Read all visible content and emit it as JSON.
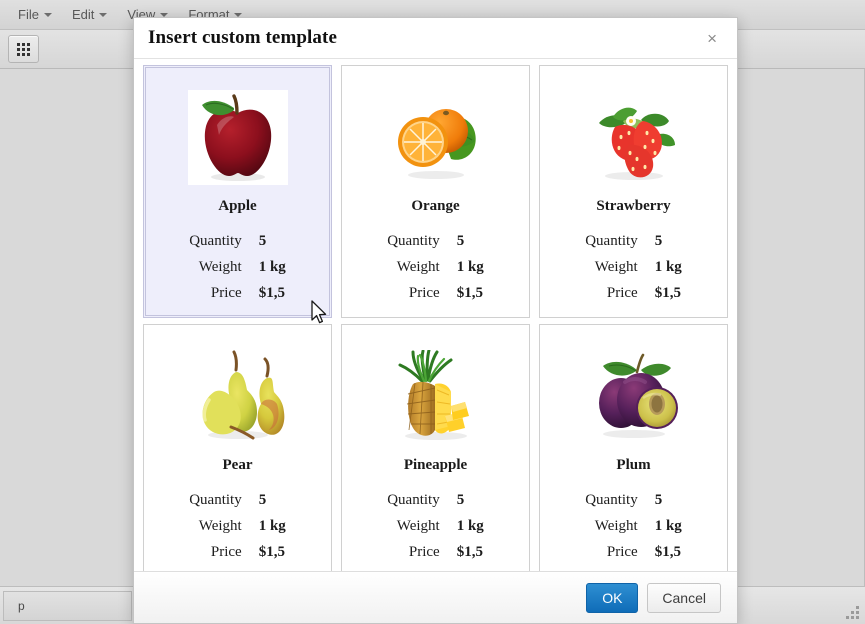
{
  "app": {
    "menubar": {
      "items": [
        {
          "label": "File",
          "has_caret": true
        },
        {
          "label": "Edit",
          "has_caret": true
        },
        {
          "label": "View",
          "has_caret": true
        },
        {
          "label": "Format",
          "has_caret": true
        }
      ]
    },
    "toolbar": {
      "buttons": [
        {
          "name": "insert-template-button",
          "icon": "grid-3x3-icon",
          "label": ""
        }
      ]
    },
    "statusbar": {
      "path": "p",
      "resize_grip": "resize-grip-icon"
    }
  },
  "dialog": {
    "title": "Insert custom template",
    "close_label": "×",
    "spec_labels": {
      "quantity": "Quantity",
      "weight": "Weight",
      "price": "Price"
    },
    "cards": [
      {
        "id": "apple",
        "title": "Apple",
        "image": "apple-image",
        "selected": true,
        "quantity": "5",
        "weight": "1 kg",
        "price": "$1,5"
      },
      {
        "id": "orange",
        "title": "Orange",
        "image": "orange-image",
        "selected": false,
        "quantity": "5",
        "weight": "1 kg",
        "price": "$1,5"
      },
      {
        "id": "strawberry",
        "title": "Strawberry",
        "image": "strawberry-image",
        "selected": false,
        "quantity": "5",
        "weight": "1 kg",
        "price": "$1,5"
      },
      {
        "id": "pear",
        "title": "Pear",
        "image": "pear-image",
        "selected": false,
        "quantity": "5",
        "weight": "1 kg",
        "price": "$1,5"
      },
      {
        "id": "pineapple",
        "title": "Pineapple",
        "image": "pineapple-image",
        "selected": false,
        "quantity": "5",
        "weight": "1 kg",
        "price": "$1,5"
      },
      {
        "id": "plum",
        "title": "Plum",
        "image": "plum-image",
        "selected": false,
        "quantity": "5",
        "weight": "1 kg",
        "price": "$1,5"
      }
    ],
    "footer": {
      "ok_label": "OK",
      "cancel_label": "Cancel"
    }
  },
  "colors": {
    "primary_button": "#0f6cb8",
    "selected_card_bg": "#eeeefb",
    "selected_card_border": "#c3c3dd",
    "chrome_bg": "#d9d9d9"
  }
}
